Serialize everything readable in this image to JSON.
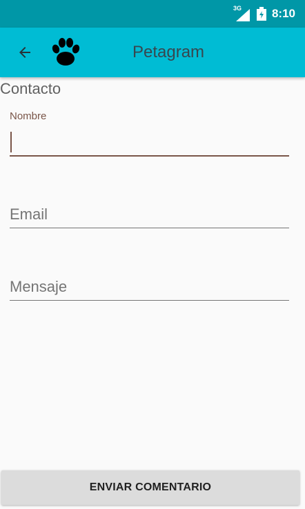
{
  "status_bar": {
    "network": "3G",
    "time": "8:10",
    "icons": [
      "signal-icon",
      "battery-charging-icon"
    ]
  },
  "app_bar": {
    "title": "Petagram",
    "back_icon": "arrow-back-icon",
    "logo_icon": "paw-icon"
  },
  "section": {
    "title": "Contacto"
  },
  "form": {
    "nombre": {
      "label": "Nombre",
      "value": ""
    },
    "email": {
      "placeholder": "Email",
      "value": ""
    },
    "mensaje": {
      "placeholder": "Mensaje",
      "value": ""
    }
  },
  "actions": {
    "send_label": "ENVIAR COMENTARIO"
  },
  "colors": {
    "status_bar": "#0097a7",
    "app_bar": "#00bcd4",
    "accent": "#795548",
    "background": "#fafafa",
    "button": "#dcdcdc"
  }
}
